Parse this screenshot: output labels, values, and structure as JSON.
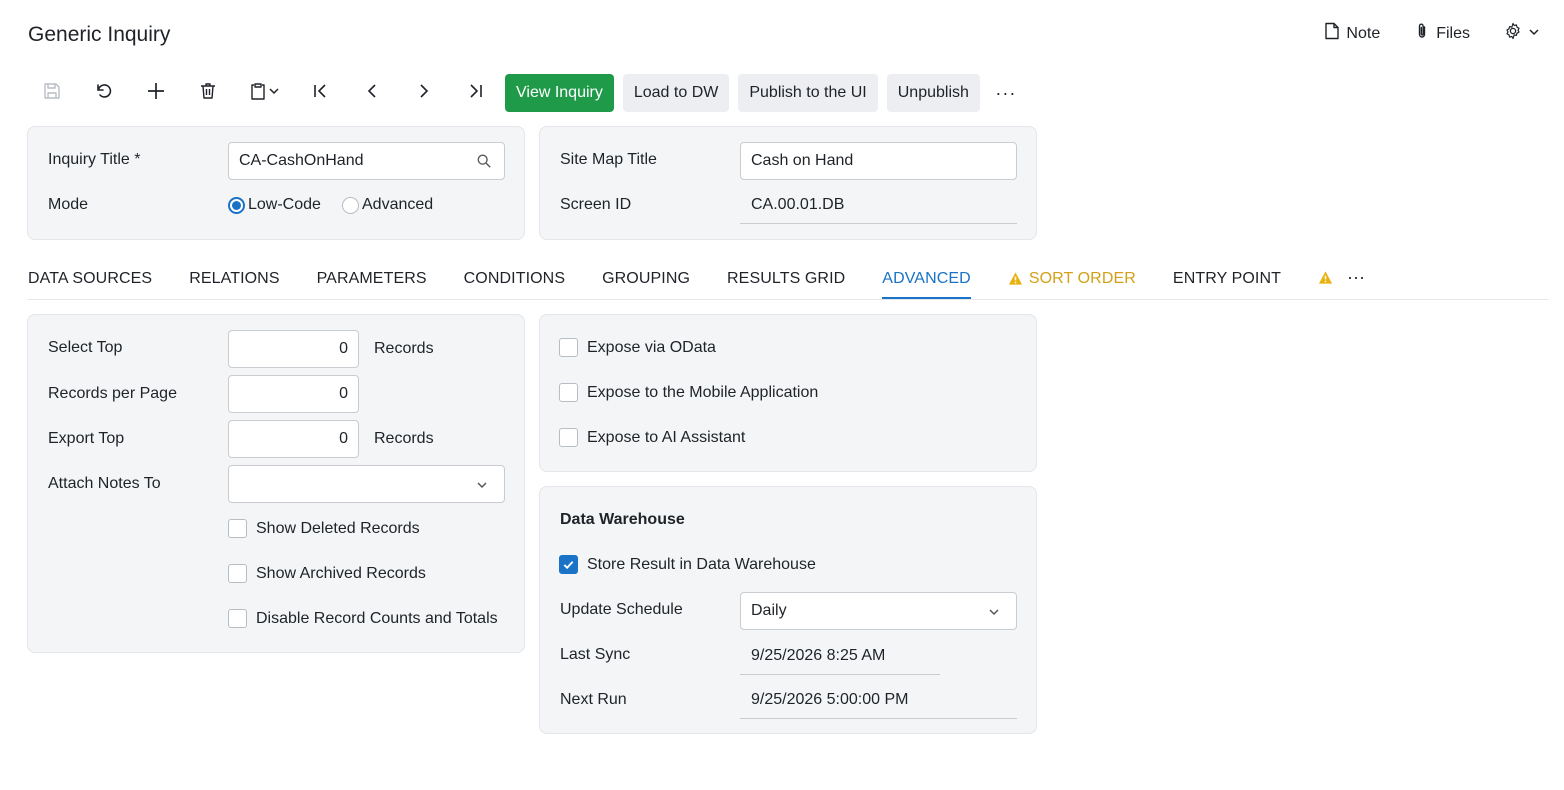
{
  "header": {
    "title": "Generic Inquiry",
    "note_label": "Note",
    "files_label": "Files"
  },
  "toolbar": {
    "view_inquiry": "View Inquiry",
    "load_to_dw": "Load to DW",
    "publish": "Publish to the UI",
    "unpublish": "Unpublish",
    "more": "···"
  },
  "summary": {
    "inquiry_title_label": "Inquiry Title",
    "inquiry_title_required": "*",
    "inquiry_title_value": "CA-CashOnHand",
    "mode_label": "Mode",
    "mode_options": [
      "Low-Code",
      "Advanced"
    ],
    "mode_selected": "Low-Code",
    "site_map_title_label": "Site Map Title",
    "site_map_title_value": "Cash on Hand",
    "screen_id_label": "Screen ID",
    "screen_id_value": "CA.00.01.DB"
  },
  "tabs": [
    {
      "label": "DATA SOURCES",
      "state": "normal"
    },
    {
      "label": "RELATIONS",
      "state": "normal"
    },
    {
      "label": "PARAMETERS",
      "state": "normal"
    },
    {
      "label": "CONDITIONS",
      "state": "normal"
    },
    {
      "label": "GROUPING",
      "state": "normal"
    },
    {
      "label": "RESULTS GRID",
      "state": "normal"
    },
    {
      "label": "ADVANCED",
      "state": "active"
    },
    {
      "label": "SORT ORDER",
      "state": "warning"
    },
    {
      "label": "ENTRY POINT",
      "state": "normal"
    }
  ],
  "tabs_more": "···",
  "advanced": {
    "select_top_label": "Select Top",
    "select_top_value": "0",
    "select_top_suffix": "Records",
    "records_per_page_label": "Records per Page",
    "records_per_page_value": "0",
    "export_top_label": "Export Top",
    "export_top_value": "0",
    "export_top_suffix": "Records",
    "attach_notes_label": "Attach Notes To",
    "attach_notes_value": "",
    "show_deleted_label": "Show Deleted Records",
    "show_deleted_checked": false,
    "show_archived_label": "Show Archived Records",
    "show_archived_checked": false,
    "disable_counts_label": "Disable Record Counts and Totals",
    "disable_counts_checked": false
  },
  "expose": {
    "odata_label": "Expose via OData",
    "odata_checked": false,
    "mobile_label": "Expose to the Mobile Application",
    "mobile_checked": false,
    "ai_label": "Expose to AI Assistant",
    "ai_checked": false
  },
  "warehouse": {
    "title": "Data Warehouse",
    "store_label": "Store Result in Data Warehouse",
    "store_checked": true,
    "schedule_label": "Update Schedule",
    "schedule_value": "Daily",
    "last_sync_label": "Last Sync",
    "last_sync_value": "9/25/2026 8:25 AM",
    "next_run_label": "Next Run",
    "next_run_value": "9/25/2026 5:00:00 PM"
  },
  "colors": {
    "primary_green": "#1e9a49",
    "accent_blue": "#1a73c6",
    "warning": "#d4a017"
  }
}
